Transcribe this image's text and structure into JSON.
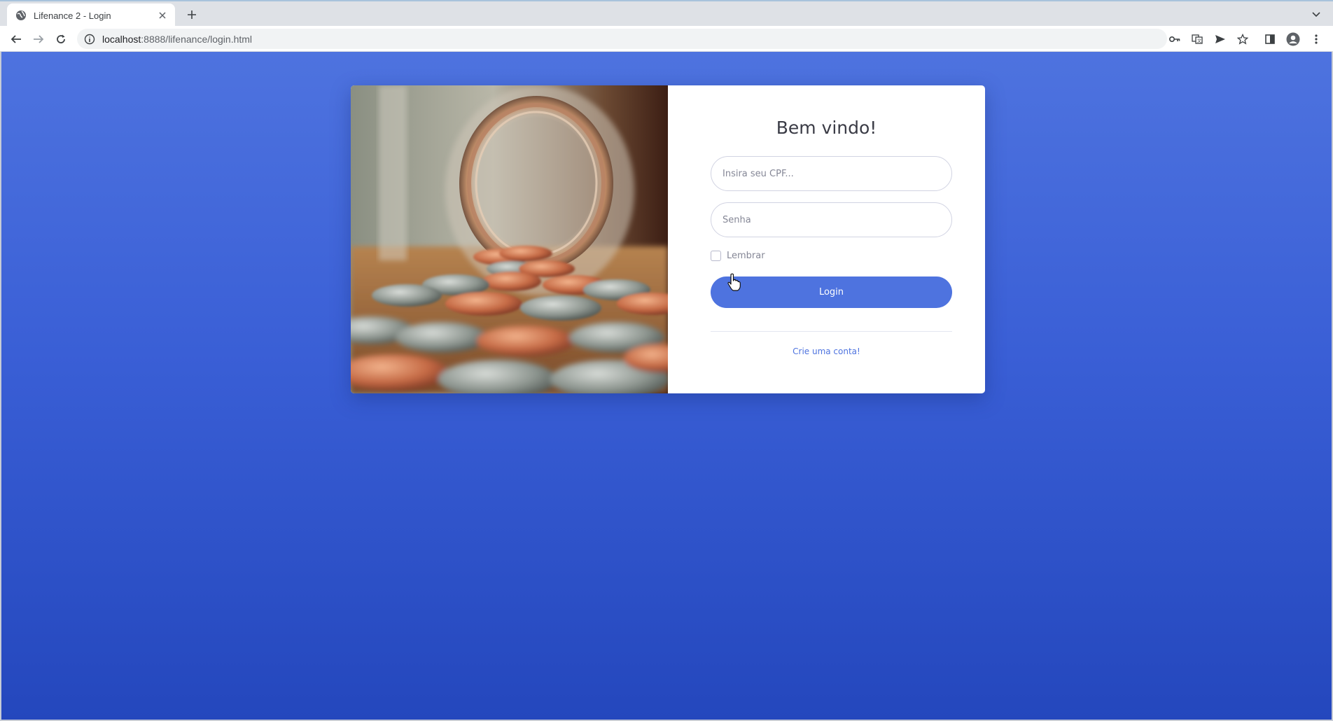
{
  "browser": {
    "tab_title": "Lifenance 2 - Login",
    "url_host": "localhost",
    "url_path": ":8888/lifenance/login.html"
  },
  "login": {
    "heading": "Bem vindo!",
    "cpf_placeholder": "Insira seu CPF...",
    "password_placeholder": "Senha",
    "remember_label": "Lembrar",
    "submit_label": "Login",
    "create_account_link": "Crie uma conta!"
  },
  "colors": {
    "primary": "#4e73df",
    "background_top": "#4e73df",
    "background_bottom": "#2447bd"
  },
  "icons": [
    "globe-icon",
    "close-icon",
    "plus-icon",
    "back-icon",
    "forward-icon",
    "reload-icon",
    "info-icon",
    "key-icon",
    "translate-icon",
    "send-icon",
    "star-icon",
    "sidebar-icon",
    "profile-icon",
    "menu-icon"
  ]
}
